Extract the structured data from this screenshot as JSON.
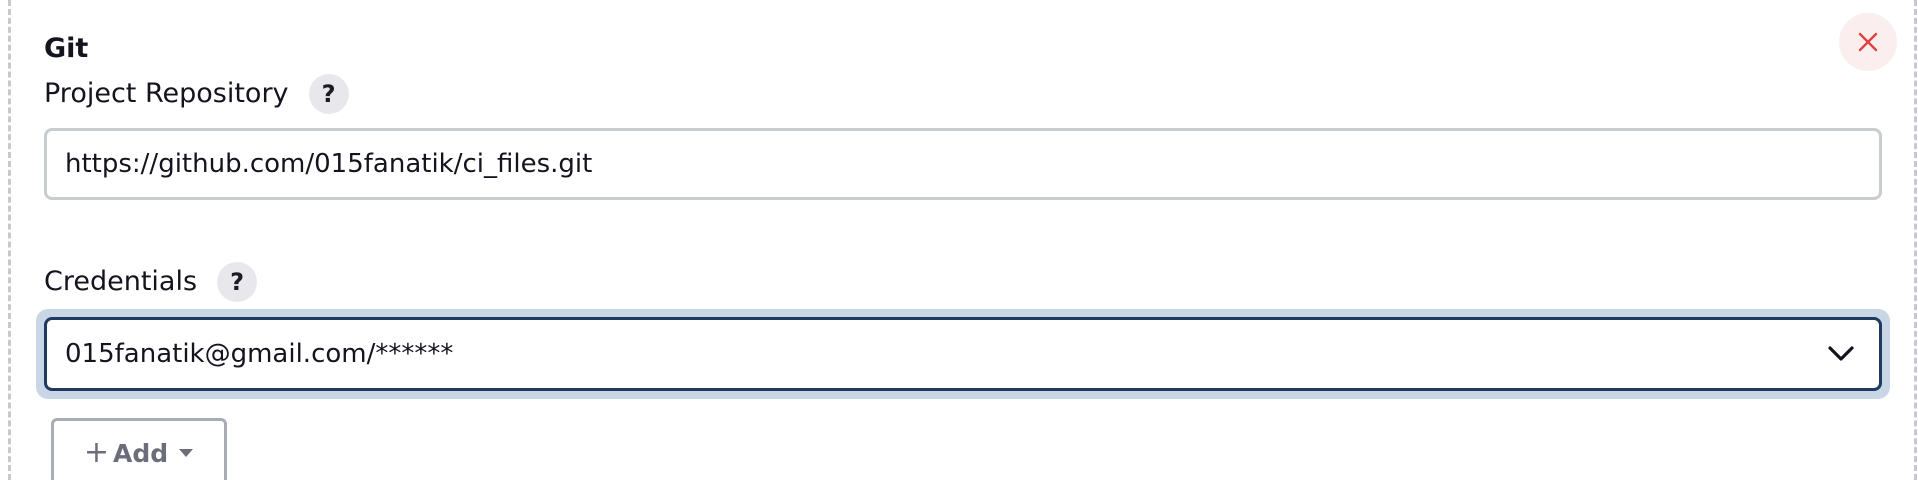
{
  "section": {
    "title": "Git"
  },
  "close_button": {
    "icon": "close-icon",
    "color": "#e0413f"
  },
  "repository": {
    "label": "Project Repository",
    "help_label": "?",
    "value": "https://github.com/015fanatik/ci_files.git"
  },
  "credentials": {
    "label": "Credentials",
    "help_label": "?",
    "selected": "015fanatik@gmail.com/******",
    "icon": "chevron-down-icon",
    "focus_color": "#1f3a5f"
  },
  "add_button": {
    "plus": "+",
    "label": "Add",
    "icon": "caret-down-icon"
  }
}
